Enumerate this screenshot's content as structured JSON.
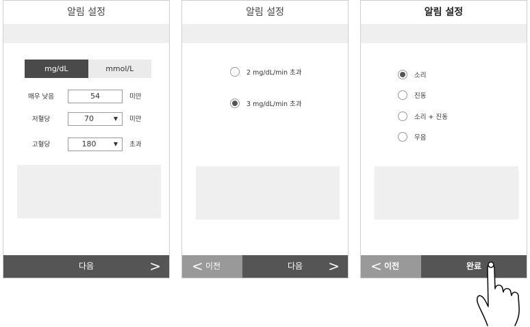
{
  "screen1": {
    "title": "알림 설정",
    "units": [
      "mg/dL",
      "mmol/L"
    ],
    "selected_unit": "mg/dL",
    "rows": [
      {
        "label": "매우 낮음",
        "value": "54",
        "dropdown": false,
        "unit": "미만"
      },
      {
        "label": "저혈당",
        "value": "70",
        "dropdown": true,
        "unit": "미만"
      },
      {
        "label": "고혈당",
        "value": "180",
        "dropdown": true,
        "unit": "초과"
      }
    ],
    "footer": {
      "next_label": "다음",
      "next_chevron": ">"
    }
  },
  "screen2": {
    "title": "알림 설정",
    "options": [
      {
        "label": "2 mg/dL/min 초과",
        "checked": false
      },
      {
        "label": "3 mg/dL/min 초과",
        "checked": true
      }
    ],
    "footer": {
      "prev_chevron": "<",
      "prev_label": "이전",
      "next_label": "다음",
      "next_chevron": ">"
    }
  },
  "screen3": {
    "title": "알림 설정",
    "options": [
      {
        "label": "소리",
        "checked": true
      },
      {
        "label": "진동",
        "checked": false
      },
      {
        "label": "소리 + 진동",
        "checked": false
      },
      {
        "label": "무음",
        "checked": false
      }
    ],
    "footer": {
      "prev_chevron": "<",
      "prev_label": "이전",
      "done_label": "완료"
    }
  },
  "icons": {
    "caret": "▼",
    "hand": "hand-pointer-icon"
  }
}
